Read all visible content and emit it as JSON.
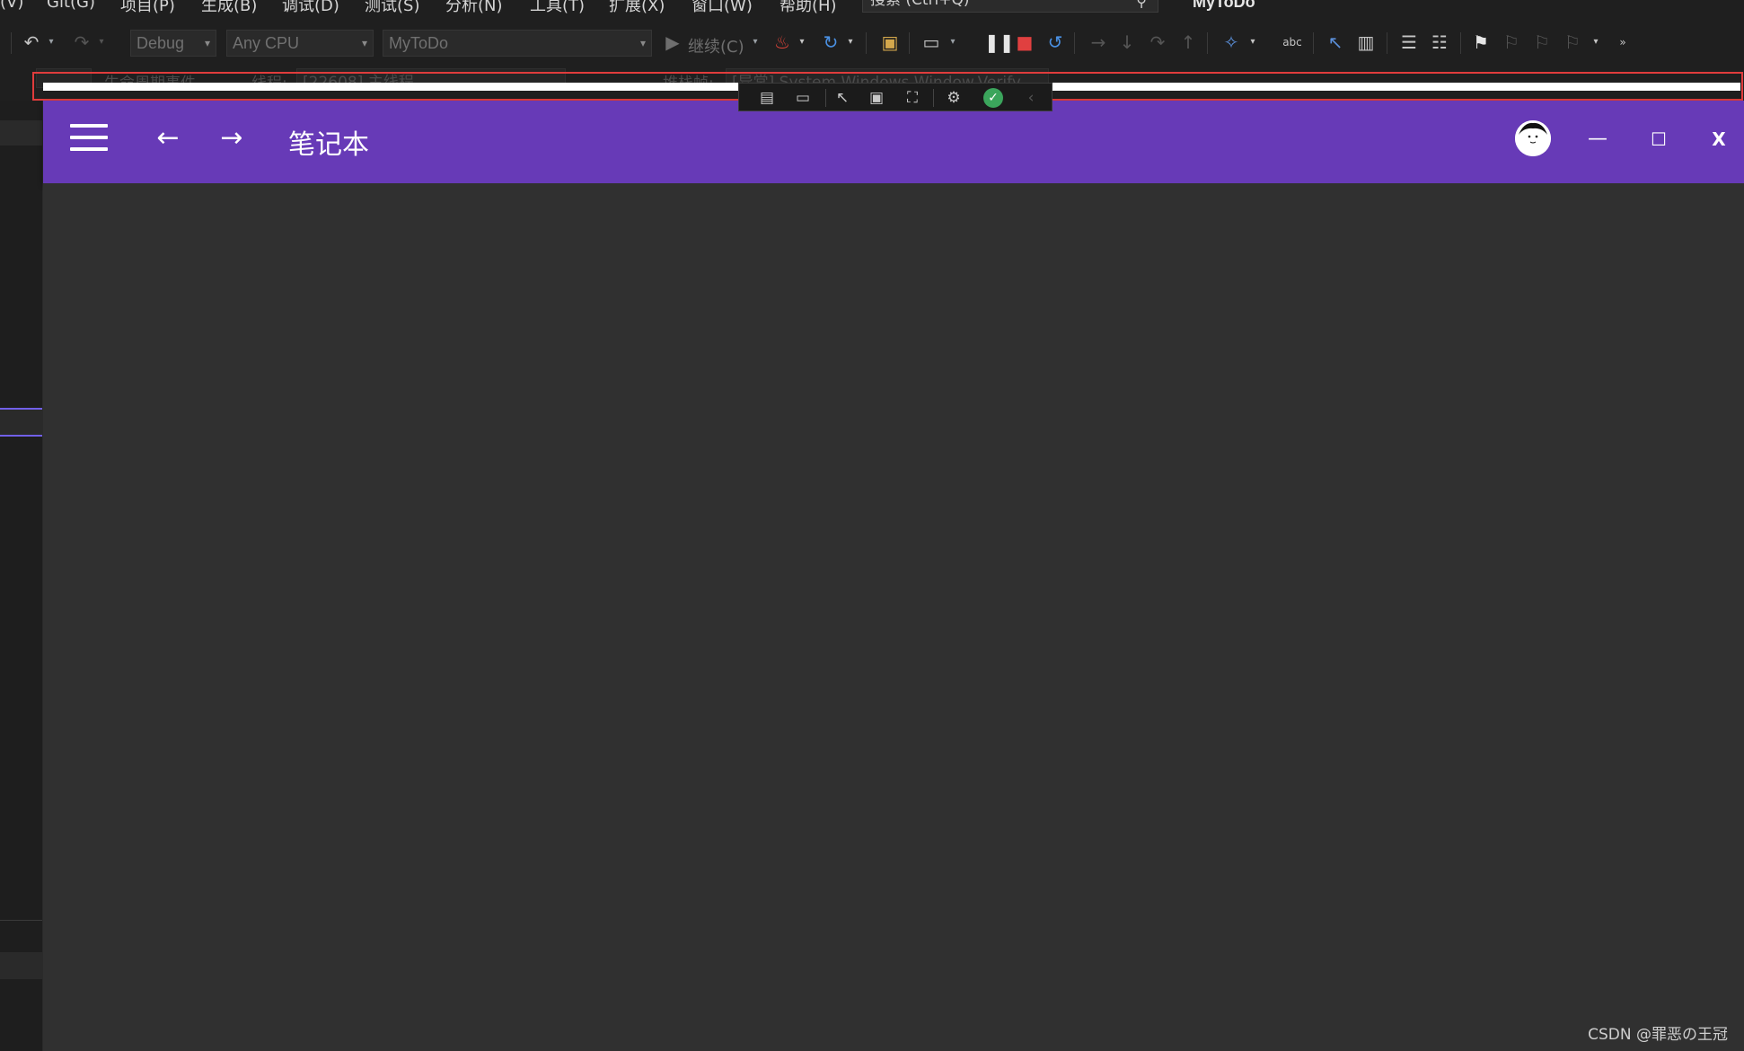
{
  "menubar": {
    "items": [
      "(V)",
      "Git(G)",
      "项目(P)",
      "生成(B)",
      "调试(D)",
      "测试(S)",
      "分析(N)",
      "工具(T)",
      "扩展(X)",
      "窗口(W)",
      "帮助(H)"
    ],
    "search_placeholder": "搜索 (Ctrl+Q)",
    "solution_name": "MyToDo"
  },
  "toolbar": {
    "config": "Debug",
    "platform": "Any CPU",
    "startup_project": "MyToDo",
    "continue_label": "继续(C)"
  },
  "debugbar": {
    "lifecycle_label": "生命周期事件",
    "thread_label": "线程:",
    "thread_value": "[22608] 主线程",
    "stackframe_label": "堆栈帧:",
    "stackframe_value": "[异常] System.Windows.Window.Verify"
  },
  "app": {
    "title": "笔记本",
    "header_color": "#673ab7",
    "minimize_glyph": "—",
    "maximize_glyph": "☐",
    "close_glyph": "X"
  },
  "watermark": "CSDN @罪恶の王冠"
}
